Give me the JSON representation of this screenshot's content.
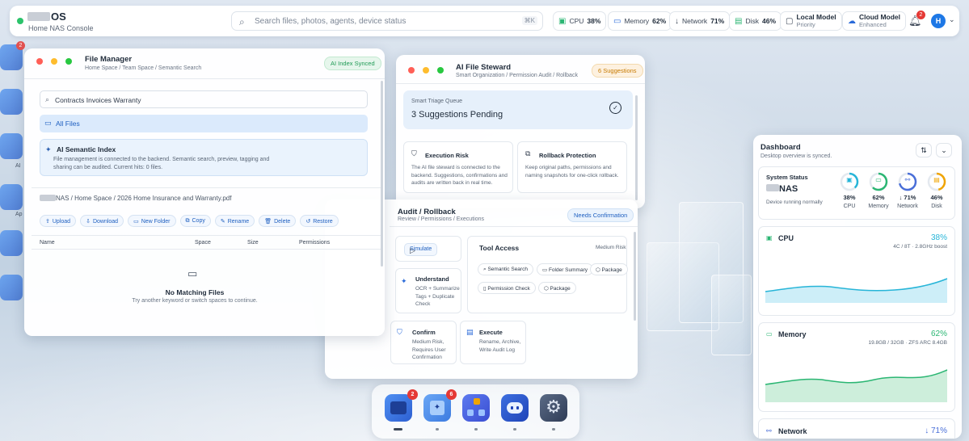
{
  "topbar": {
    "os_name": "OS",
    "subtitle": "Home NAS Console",
    "search_placeholder": "Search files, photos, agents, device status",
    "search_shortcut": "⌘K",
    "cpu_label": "CPU",
    "cpu_value": "38%",
    "memory_label": "Memory",
    "memory_value": "62%",
    "network_label": "Network",
    "network_value": "71%",
    "disk_label": "Disk",
    "disk_value": "46%",
    "local_model_label": "Local Model",
    "local_model_value": "Priority",
    "cloud_model_label": "Cloud Model",
    "cloud_model_value": "Enhanced",
    "notification_count": "2",
    "avatar_initial": "H"
  },
  "left_dock": {
    "badge": "2",
    "label_ai": "AI",
    "label_ap": "Ap"
  },
  "file_manager": {
    "title": "File Manager",
    "breadcrumb": "Home Space / Team Space / Semantic Search",
    "badge": "AI Index Synced",
    "search_value": "Contracts Invoices Warranty",
    "all_files": "All Files",
    "semantic_title": "AI Semantic Index",
    "semantic_desc": "File management is connected to the backend. Semantic search, preview, tagging and sharing can be audited. Current hits: 0 files.",
    "path": "NAS / Home Space / 2026 Home Insurance and Warranty.pdf",
    "buttons": [
      "Upload",
      "Download",
      "New Folder",
      "Copy",
      "Rename",
      "Delete",
      "Restore"
    ],
    "columns": [
      "Name",
      "Space",
      "Size",
      "Permissions"
    ],
    "empty_title": "No Matching Files",
    "empty_desc": "Try another keyword or switch spaces to continue."
  },
  "steward": {
    "title": "AI File Steward",
    "subtitle": "Smart Organization / Permission Audit / Rollback",
    "badge": "6 Suggestions",
    "queue_label": "Smart Triage Queue",
    "queue_value": "3 Suggestions Pending",
    "risk_title": "Execution Risk",
    "risk_desc": "The AI file steward is connected to the backend. Suggestions, confirmations and audits are written back in real time.",
    "rollback_title": "Rollback Protection",
    "rollback_desc": "Keep original paths, permissions and naming snapshots for one-click rollback."
  },
  "audit": {
    "title": "Audit / Rollback",
    "subtitle": "Review / Permissions / Executions",
    "badge": "Needs Confirmation",
    "simulate": "Simulate",
    "understand_title": "Understand",
    "understand_desc": "OCR + Summarize Tags + Duplicate Check",
    "tool_access": "Tool Access",
    "risk_level": "Medium Risk",
    "tools": [
      "Semantic Search",
      "Folder Summary",
      "Package",
      "Permission Check",
      "Package"
    ],
    "confirm_title": "Confirm",
    "confirm_desc": "Medium Risk, Requires User Confirmation",
    "execute_title": "Execute",
    "execute_desc": "Rename, Archive, Write Audit Log"
  },
  "dashboard": {
    "title": "Dashboard",
    "subtitle": "Desktop overview is synced.",
    "system_status": "System Status",
    "device_name": "NAS",
    "device_state": "Device running normally",
    "metrics": [
      {
        "label": "CPU",
        "value": "38%",
        "fraction": 0.38,
        "color": "#27b5d8"
      },
      {
        "label": "Memory",
        "value": "62%",
        "fraction": 0.62,
        "color": "#2bb673"
      },
      {
        "label": "Network",
        "value": "↓ 71%",
        "fraction": 0.71,
        "color": "#4a6fd8"
      },
      {
        "label": "Disk",
        "value": "46%",
        "fraction": 0.46,
        "color": "#f0a400"
      }
    ],
    "cpu_title": "CPU",
    "cpu_pct": "38%",
    "cpu_detail": "4C / 8T · 2.8GHz boost",
    "mem_title": "Memory",
    "mem_pct": "62%",
    "mem_detail": "19.8GB / 32GB · ZFS ARC 8.4GB",
    "net_title": "Network",
    "net_pct": "↓ 71%"
  },
  "bottom_dock": {
    "apps": [
      {
        "name": "Files",
        "badge": "2"
      },
      {
        "name": "AI Gallery",
        "badge": "6"
      },
      {
        "name": "Workflow",
        "badge": ""
      },
      {
        "name": "Assistant",
        "badge": ""
      },
      {
        "name": "Settings",
        "badge": ""
      }
    ]
  },
  "colors": {
    "accent": "#1e78e6",
    "success": "#2cc36b",
    "danger": "#e53935"
  }
}
